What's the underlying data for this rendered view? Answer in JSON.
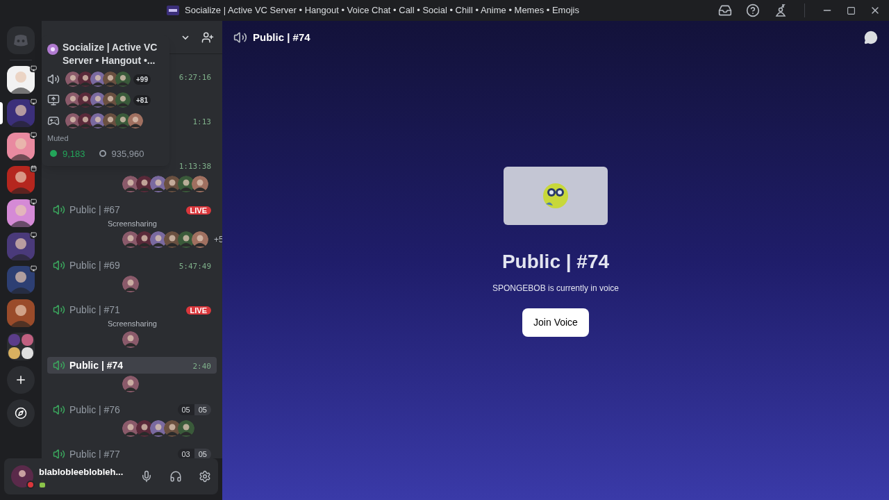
{
  "window": {
    "title": "Socialize | Active VC Server • Hangout • Voice Chat • Call • Social • Chill • Anime • Memes • Emojis"
  },
  "servers": [
    {
      "kind": "streaming",
      "selected": false,
      "color": "#f2f2f2"
    },
    {
      "kind": "streaming",
      "selected": true,
      "color": "#3b2f7a"
    },
    {
      "kind": "streaming",
      "selected": false,
      "color": "#e98aa0"
    },
    {
      "kind": "event",
      "selected": false,
      "color": "#b5261e"
    },
    {
      "kind": "streaming",
      "selected": false,
      "color": "#d58ad6"
    },
    {
      "kind": "streaming",
      "selected": false,
      "color": "#4a3a7a"
    },
    {
      "kind": "streaming",
      "selected": false,
      "color": "#2d3f73"
    },
    {
      "kind": "plain",
      "selected": false,
      "color": "#9a4b2a"
    },
    {
      "kind": "folder",
      "selected": false,
      "color": "#5b3d8a"
    }
  ],
  "tooltip": {
    "title": "Socialize | Active VC Server • Hangout •...",
    "rows": [
      {
        "kind": "voice",
        "extra": "+99"
      },
      {
        "kind": "stream",
        "extra": "+81"
      },
      {
        "kind": "game"
      }
    ],
    "status": "Muted",
    "online": "9,183",
    "members": "935,960"
  },
  "channels": [
    {
      "selected": false,
      "badge": {
        "kind": "timer",
        "text": "6:27:16"
      }
    },
    {
      "selected": false,
      "badge": {
        "kind": "timer",
        "text": "1:13"
      }
    },
    {
      "selected": false,
      "badge": {
        "kind": "timer",
        "text": "1:13:38"
      }
    },
    {
      "name": "Public | #67",
      "subtitle": "Screensharing",
      "selected": false,
      "badge": {
        "kind": "live",
        "text": "LIVE"
      },
      "extra": "+5"
    },
    {
      "name": "Public | #69",
      "selected": false,
      "badge": {
        "kind": "timer",
        "text": "5:47:49"
      }
    },
    {
      "name": "Public | #71",
      "subtitle": "Screensharing",
      "selected": false,
      "badge": {
        "kind": "live",
        "text": "LIVE"
      }
    },
    {
      "name": "Public | #74",
      "selected": true,
      "badge": {
        "kind": "timer",
        "text": "2:40"
      }
    },
    {
      "name": "Public | #76",
      "selected": false,
      "badge": {
        "kind": "counter",
        "parts": [
          "05",
          "05"
        ]
      }
    },
    {
      "name": "Public | #77",
      "selected": false,
      "badge": {
        "kind": "counter",
        "parts": [
          "03",
          "05"
        ]
      }
    }
  ],
  "user": {
    "name": "blablobleeblobleh..."
  },
  "main": {
    "channel": "Public | #74",
    "title": "Public | #74",
    "caption": "SPONGEBOB is currently in voice",
    "button": "Join Voice"
  }
}
